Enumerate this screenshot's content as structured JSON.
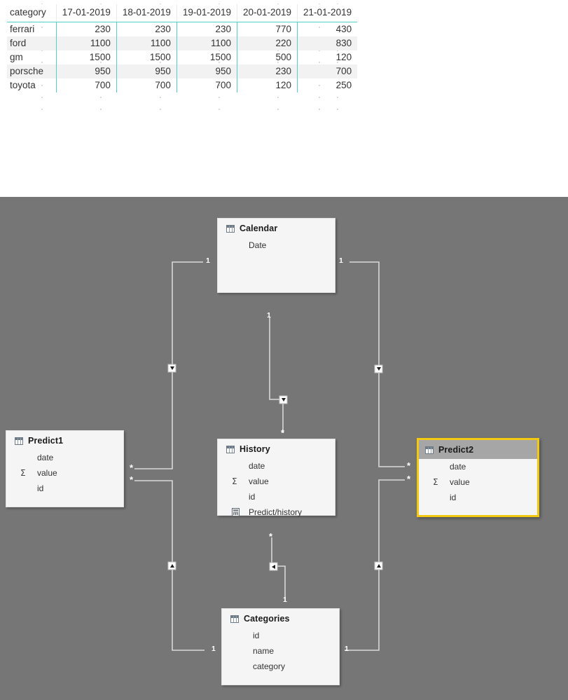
{
  "matrix": {
    "name": "category-by-date-matrix",
    "columns": [
      "category",
      "17-01-2019",
      "18-01-2019",
      "19-01-2019",
      "20-01-2019",
      "21-01-2019"
    ],
    "rows": [
      {
        "category": "ferrari",
        "values": [
          230,
          230,
          230,
          770,
          430
        ]
      },
      {
        "category": "ford",
        "values": [
          1100,
          1100,
          1100,
          220,
          830
        ]
      },
      {
        "category": "gm",
        "values": [
          1500,
          1500,
          1500,
          500,
          120
        ]
      },
      {
        "category": "porsche",
        "values": [
          950,
          950,
          950,
          230,
          700
        ]
      },
      {
        "category": "toyota",
        "values": [
          700,
          700,
          700,
          120,
          250
        ]
      }
    ],
    "accent_color": "#4fd0c9",
    "alt_row_color": "#f2f2f2"
  },
  "diagram": {
    "canvas_color": "#767676",
    "selection_color": "#f2c811",
    "tables": [
      {
        "id": "calendar",
        "name": "Calendar",
        "icon": "table-grid-icon",
        "selected": false,
        "fields": [
          {
            "label": "Date",
            "icon": "none"
          }
        ]
      },
      {
        "id": "predict1",
        "name": "Predict1",
        "icon": "table-grid-icon",
        "selected": false,
        "fields": [
          {
            "label": "date",
            "icon": "none"
          },
          {
            "label": "value",
            "icon": "sigma-icon"
          },
          {
            "label": "id",
            "icon": "none"
          }
        ]
      },
      {
        "id": "history",
        "name": "History",
        "icon": "table-grid-icon",
        "selected": false,
        "fields": [
          {
            "label": "date",
            "icon": "none"
          },
          {
            "label": "value",
            "icon": "sigma-icon"
          },
          {
            "label": "id",
            "icon": "none"
          },
          {
            "label": "Predict/history",
            "icon": "calculator-icon"
          }
        ]
      },
      {
        "id": "predict2",
        "name": "Predict2",
        "icon": "table-grid-icon",
        "selected": true,
        "fields": [
          {
            "label": "date",
            "icon": "none"
          },
          {
            "label": "value",
            "icon": "sigma-icon"
          },
          {
            "label": "id",
            "icon": "none"
          }
        ]
      },
      {
        "id": "categories",
        "name": "Categories",
        "icon": "table-grid-icon",
        "selected": false,
        "fields": [
          {
            "label": "id",
            "icon": "none"
          },
          {
            "label": "name",
            "icon": "none"
          },
          {
            "label": "category",
            "icon": "none"
          }
        ]
      }
    ],
    "relationships": [
      {
        "id": "calendar-predict1",
        "from": "Calendar",
        "to": "Predict1",
        "from_cardinality": "1",
        "to_cardinality": "*",
        "cross_filter": "single"
      },
      {
        "id": "calendar-history",
        "from": "Calendar",
        "to": "History",
        "from_cardinality": "1",
        "to_cardinality": "*",
        "cross_filter": "single"
      },
      {
        "id": "calendar-predict2",
        "from": "Calendar",
        "to": "Predict2",
        "from_cardinality": "1",
        "to_cardinality": "*",
        "cross_filter": "single"
      },
      {
        "id": "categories-predict1",
        "from": "Categories",
        "to": "Predict1",
        "from_cardinality": "1",
        "to_cardinality": "*",
        "cross_filter": "single"
      },
      {
        "id": "categories-history",
        "from": "Categories",
        "to": "History",
        "from_cardinality": "1",
        "to_cardinality": "*",
        "cross_filter": "single"
      },
      {
        "id": "categories-predict2",
        "from": "Categories",
        "to": "Predict2",
        "from_cardinality": "1",
        "to_cardinality": "*",
        "cross_filter": "single"
      }
    ],
    "cardinality_labels": {
      "one": "1",
      "many": "*"
    }
  }
}
